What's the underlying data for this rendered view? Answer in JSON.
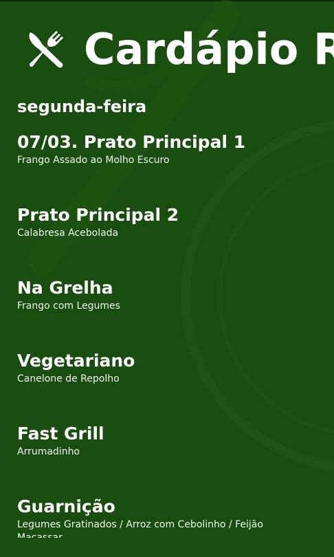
{
  "header": {
    "title": "Cardápio R",
    "icon": "fork-knife-icon"
  },
  "day": "segunda-feira",
  "menu": [
    {
      "title": "07/03. Prato Principal 1",
      "description": "Frango Assado ao Molho Escuro"
    },
    {
      "title": "Prato Principal 2",
      "description": "Calabresa Acebolada"
    },
    {
      "title": "Na Grelha",
      "description": "Frango com Legumes"
    },
    {
      "title": "Vegetariano",
      "description": "Canelone de Repolho"
    },
    {
      "title": "Fast Grill",
      "description": "Arrumadinho"
    },
    {
      "title": "Guarnição",
      "description": "Legumes Gratinados / Arroz com Cebolinho / Feijão Macassar"
    }
  ],
  "colors": {
    "background": "#1a4d10",
    "text": "#ffffff"
  }
}
